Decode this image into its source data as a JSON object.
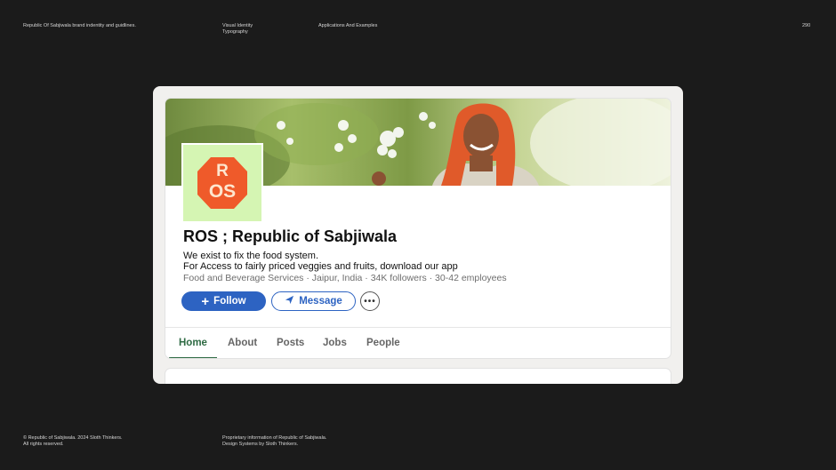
{
  "document": {
    "header": {
      "brand_line": "Republic Of Sabjiwala brand indentity and guidlines.",
      "section_1": "Visual Identity",
      "section_2": "Typography",
      "section_3": "Applications And Examples",
      "page_number": "290"
    },
    "footer": {
      "copyright": "© Republic of Sabjiwala. 2024 Sloth Thinkers.\nAll rights reserved.",
      "proprietary": "Proprietary information of Republic of Sabjiwala.\nDesign Systems by Sloth Thinkers."
    }
  },
  "profile": {
    "logo_text_top": "R",
    "logo_text_bottom": "OS",
    "logo_colors": {
      "background": "#d5f5b3",
      "hexagon": "#ef5a2a"
    },
    "company_name": "ROS ; Republic of Sabjiwala",
    "tagline_1": "We exist to fix the food system.",
    "tagline_2": "For Access to fairly priced veggies and fruits, download our app",
    "meta_line": "Food and Beverage Services · Jaipur, India · 34K followers · 30-42 employees",
    "actions": {
      "follow_label": "Follow",
      "message_label": "Message",
      "follow_icon": "plus-icon",
      "message_icon": "send-icon",
      "more_icon": "more-options-icon"
    },
    "tabs": [
      {
        "label": "Home",
        "active": true
      },
      {
        "label": "About",
        "active": false
      },
      {
        "label": "Posts",
        "active": false
      },
      {
        "label": "Jobs",
        "active": false
      },
      {
        "label": "People",
        "active": false
      }
    ],
    "accent_colors": {
      "primary": "#2d63c2",
      "tab_active": "#2f6b44"
    }
  }
}
